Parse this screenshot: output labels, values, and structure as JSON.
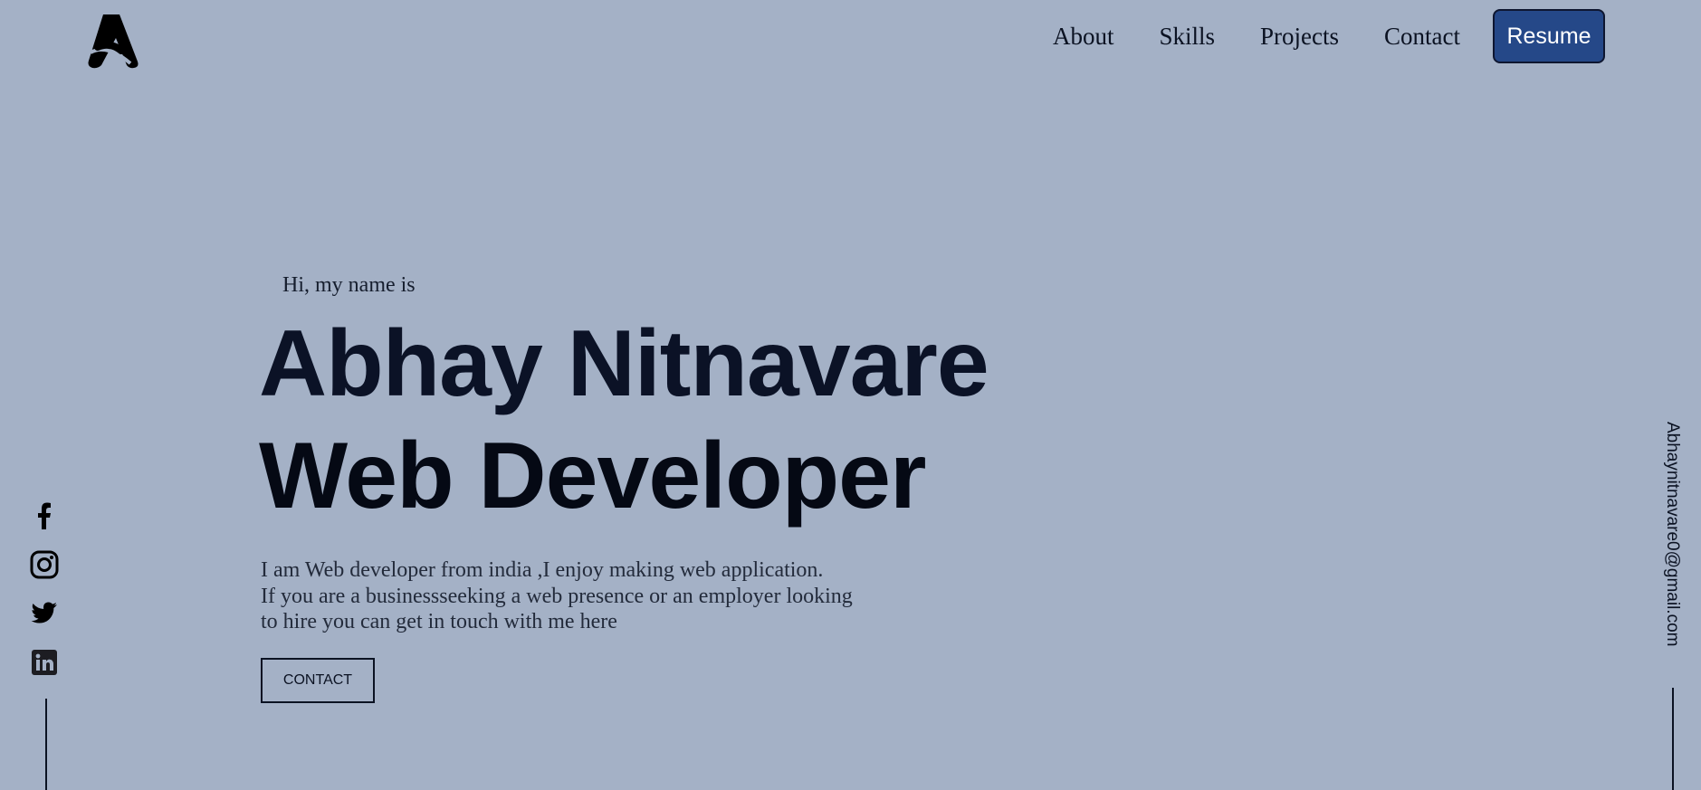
{
  "header": {
    "logo_icon": "a-logo-icon",
    "nav": [
      "About",
      "Skills",
      "Projects",
      "Contact"
    ],
    "resume_label": "Resume"
  },
  "hero": {
    "greeting": "Hi, my name is",
    "name": "Abhay Nitnavare",
    "role": "Web Developer",
    "intro_lines": [
      "I am Web developer from india ,I enjoy making web application.",
      "If you are a businessseeking a web presence or an employer looking",
      "to hire you can get in touch with me here"
    ],
    "contact_label": "CONTACT"
  },
  "socials": [
    "facebook-icon",
    "instagram-icon",
    "twitter-icon",
    "linkedin-icon"
  ],
  "email": "Abhaynitnavare0@gmail.com",
  "colors": {
    "background": "#a4b1c6",
    "accent": "#254888",
    "text": "#0b1222"
  }
}
